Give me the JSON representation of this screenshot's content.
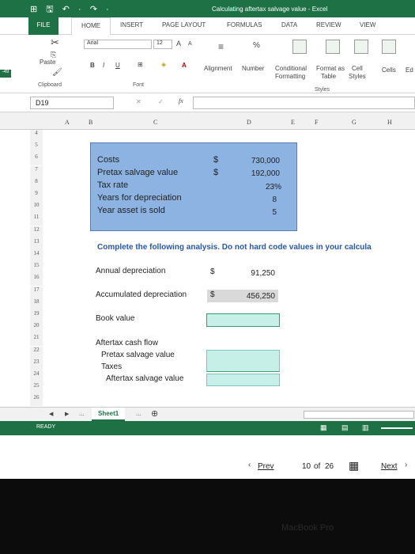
{
  "window": {
    "title": "Calculating aftertax salvage value - Excel",
    "qat": "⊞ 🖫 ↶ · ↷ ·"
  },
  "tabs": [
    "FILE",
    "HOME",
    "INSERT",
    "PAGE LAYOUT",
    "FORMULAS",
    "DATA",
    "REVIEW",
    "VIEW"
  ],
  "ribbon": {
    "font_name": "Arial",
    "font_size": "12",
    "paste": "Paste",
    "clipboard": "Clipboard",
    "font": "Font",
    "bold": "B",
    "italic": "I",
    "underline": "U",
    "grow": "A",
    "shrink": "A",
    "alignment": "Alignment",
    "number": "Number",
    "percent": "%",
    "conditional": "Conditional",
    "formatting": "Formatting",
    "format_as": "Format as",
    "table": "Table",
    "cell": "Cell",
    "styles_btn": "Styles",
    "cells": "Cells",
    "ed": "Ed",
    "styles": "Styles",
    "side_badge": "-49"
  },
  "formula_bar": {
    "name_box": "D19",
    "fx": "fx"
  },
  "columns": [
    "A",
    "B",
    "C",
    "D",
    "E",
    "F",
    "G",
    "H"
  ],
  "rows": [
    "4",
    "5",
    "6",
    "7",
    "8",
    "9",
    "10",
    "11",
    "12",
    "13",
    "14",
    "15",
    "16",
    "17",
    "18",
    "19",
    "20",
    "21",
    "22",
    "23",
    "24",
    "25",
    "26"
  ],
  "inputs": {
    "costs_label": "Costs",
    "costs_dollar": "$",
    "costs_value": "730,000",
    "salvage_label": "Pretax salvage value",
    "salvage_dollar": "$",
    "salvage_value": "192,000",
    "tax_label": "Tax rate",
    "tax_value": "23%",
    "years_label": "Years for depreciation",
    "years_value": "8",
    "sold_label": "Year asset is sold",
    "sold_value": "5"
  },
  "analysis": {
    "instruction": "Complete the following analysis. Do not hard code values in your calcula",
    "annual_dep_label": "Annual depreciation",
    "annual_dep_dollar": "$",
    "annual_dep_value": "91,250",
    "accum_dep_label": "Accumulated depreciation",
    "accum_dep_dollar": "$",
    "accum_dep_value": "456,250",
    "book_value_label": "Book value",
    "cash_flow_label": "Aftertax cash flow",
    "pretax_label": "Pretax salvage value",
    "taxes_label": "Taxes",
    "aftertax_label": "Aftertax salvage value"
  },
  "sheet": {
    "nav_prev": "◀",
    "nav_next": "▶",
    "ellipsis": "...",
    "active": "Sheet1",
    "ellipsis2": "...",
    "add": "⊕"
  },
  "status": {
    "text": "READY"
  },
  "pager": {
    "prev": "Prev",
    "page": "10",
    "of": "of",
    "total": "26",
    "next": "Next"
  },
  "bezel": {
    "label": "MacBook Pro"
  },
  "colors": {
    "excel_green": "#1e7145",
    "input_blue": "#8db3e2",
    "answer_cell": "#c6efe8"
  }
}
